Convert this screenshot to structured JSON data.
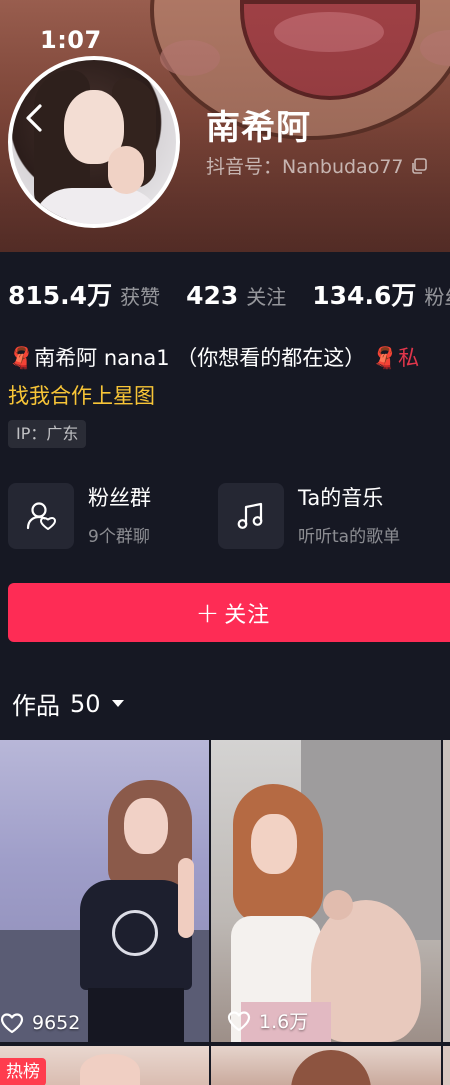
{
  "status_bar": {
    "time": "1:07"
  },
  "profile": {
    "nickname": "南希阿",
    "douyin_id": "抖音号：Nanbudao77",
    "ip": "IP：广东"
  },
  "stats": [
    {
      "value": "815.4万",
      "label": "获赞"
    },
    {
      "value": "423",
      "label": "关注"
    },
    {
      "value": "134.6万",
      "label": "粉丝"
    }
  ],
  "bio": {
    "line1_prefix": "🧣",
    "line1_text": "南希阿 nana1 （你想看的都在这）",
    "line1_suffix": "🧣私",
    "link": "找我合作上星图"
  },
  "features": {
    "fans_group": {
      "title": "粉丝群",
      "subtitle": "9个群聊",
      "icon": "fans-group-icon"
    },
    "music": {
      "title": "Ta的音乐",
      "subtitle": "听听ta的歌单",
      "icon": "music-note-icon"
    }
  },
  "follow_button": {
    "label": "关注",
    "plus": "+"
  },
  "works_tab": {
    "label": "作品",
    "count": "50"
  },
  "videos": [
    {
      "likes": "9652"
    },
    {
      "likes": "1.6万"
    }
  ],
  "hot_badge": "热榜",
  "colors": {
    "background": "#161823",
    "accent": "#fe2c55",
    "link": "#f8c537"
  }
}
